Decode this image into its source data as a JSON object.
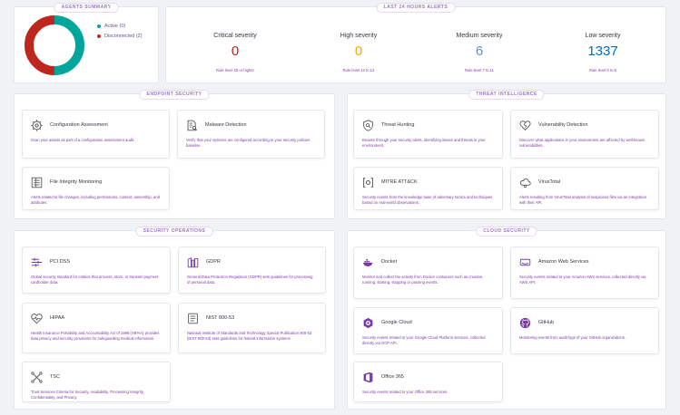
{
  "agents_summary": {
    "title": "AGENTS SUMMARY",
    "active_label": "Active (0)",
    "disconnected_label": "Disconnected (2)",
    "active_color": "#00a69b",
    "disconnected_color": "#bd271e"
  },
  "last_alerts": {
    "title": "LAST 24 HOURS ALERTS",
    "items": [
      {
        "label": "Critical severity",
        "value": "0",
        "link": "Rule level 15 or higher",
        "color": "#bd271e"
      },
      {
        "label": "High severity",
        "value": "0",
        "link": "Rule level 12 to 14",
        "color": "#f5a700"
      },
      {
        "label": "Medium severity",
        "value": "6",
        "link": "Rule level 7 to 11",
        "color": "#6092c0"
      },
      {
        "label": "Low severity",
        "value": "1337",
        "link": "Rule level 0 to 6",
        "color": "#006bb8"
      }
    ]
  },
  "sections": {
    "endpoint": {
      "title": "ENDPOINT SECURITY",
      "cards": [
        {
          "title": "Configuration Assessment",
          "desc": "Scan your assets as part of a configuration assessment audit.",
          "icon": "gear-icon"
        },
        {
          "title": "Malware Detection",
          "desc": "Verify that your systems are configured according to your security policies baseline.",
          "icon": "document-search-icon"
        },
        {
          "title": "File Integrity Monitoring",
          "desc": "Alerts related to file changes, including permissions, content, ownership, and attributes.",
          "icon": "file-list-icon"
        }
      ]
    },
    "threat": {
      "title": "THREAT INTELLIGENCE",
      "cards": [
        {
          "title": "Threat Hunting",
          "desc": "Browse through your security alerts, identifying issues and threats in your environment.",
          "icon": "shield-icon"
        },
        {
          "title": "Vulnerability Detection",
          "desc": "Discover what applications in your environment are affected by well-known vulnerabilities.",
          "icon": "heart-broken-icon"
        },
        {
          "title": "MITRE ATT&CK",
          "desc": "Security events from the knowledge base of adversary tactics and techniques based on real-world observations.",
          "icon": "mitre-icon"
        },
        {
          "title": "VirusTotal",
          "desc": "Alerts resulting from VirusTotal analysis of suspicious files via an integration with their API.",
          "icon": "cloud-bug-icon"
        }
      ]
    },
    "operations": {
      "title": "SECURITY OPERATIONS",
      "cards": [
        {
          "title": "PCI DSS",
          "desc": "Global security standard for entities that process, store, or transmit payment cardholder data.",
          "icon": "pci-icon"
        },
        {
          "title": "GDPR",
          "desc": "General Data Protection Regulation (GDPR) sets guidelines for processing of personal data.",
          "icon": "gdpr-icon"
        },
        {
          "title": "HIPAA",
          "desc": "Health Insurance Portability and Accountability Act of 1996 (HIPAA) provides data privacy and security provisions for safeguarding medical information.",
          "icon": "health-icon"
        },
        {
          "title": "NIST 800-53",
          "desc": "National Institute of Standards and Technology Special Publication 800-53 (NIST 800-53) sets guidelines for federal information systems.",
          "icon": "nist-icon"
        },
        {
          "title": "TSC",
          "desc": "Trust Services Criteria for Security, Availability, Processing Integrity, Confidentiality, and Privacy.",
          "icon": "tsc-icon"
        }
      ]
    },
    "cloud": {
      "title": "CLOUD SECURITY",
      "cards": [
        {
          "title": "Docker",
          "desc": "Monitor and collect the activity from Docker containers such as creation, running, starting, stopping or pausing events.",
          "icon": "docker-icon"
        },
        {
          "title": "Amazon Web Services",
          "desc": "Security events related to your Amazon AWS services, collected directly via AWS API.",
          "icon": "aws-icon"
        },
        {
          "title": "Google Cloud",
          "desc": "Security events related to your Google Cloud Platform services, collected directly via GCP API.",
          "icon": "google-cloud-icon"
        },
        {
          "title": "GitHub",
          "desc": "Monitoring events from audit logs of your GitHub organizations.",
          "icon": "github-icon"
        },
        {
          "title": "Office 365",
          "desc": "Security events related to your Office 365 services.",
          "icon": "office-icon"
        }
      ]
    }
  }
}
